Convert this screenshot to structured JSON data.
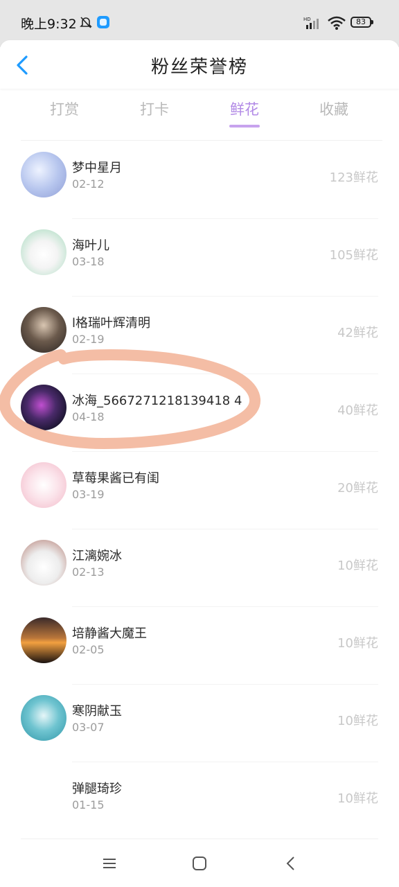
{
  "status": {
    "time": "晚上9:32",
    "battery": "83",
    "icons": [
      "bell-off-icon",
      "app-notification-icon",
      "hd-signal-icon",
      "wifi-icon",
      "battery-icon"
    ]
  },
  "header": {
    "title": "粉丝荣誉榜",
    "back_icon": "chevron-left-icon"
  },
  "tabs": [
    {
      "label": "打赏",
      "active": false
    },
    {
      "label": "打卡",
      "active": false
    },
    {
      "label": "鲜花",
      "active": true
    },
    {
      "label": "收藏",
      "active": false
    }
  ],
  "colors": {
    "accent": "#b28ae6",
    "highlight_marker": "#f3b9a0"
  },
  "fans": [
    {
      "name": "梦中星月",
      "date": "02-12",
      "value": "123鲜花"
    },
    {
      "name": "海叶儿",
      "date": "03-18",
      "value": "105鲜花"
    },
    {
      "name": "l格瑞叶辉清明",
      "date": "02-19",
      "value": "42鲜花"
    },
    {
      "name": "冰海_5667271218139418 4",
      "date": "04-18",
      "value": "40鲜花"
    },
    {
      "name": "草莓果酱已有闺",
      "date": "03-19",
      "value": "20鲜花"
    },
    {
      "name": "江漓婉冰",
      "date": "02-13",
      "value": "10鲜花"
    },
    {
      "name": "培静酱大魔王",
      "date": "02-05",
      "value": "10鲜花"
    },
    {
      "name": "寒阴献玉",
      "date": "03-07",
      "value": "10鲜花"
    },
    {
      "name": "弹腿琦珍",
      "date": "01-15",
      "value": "10鲜花"
    }
  ],
  "system_nav": [
    "menu-icon",
    "home-icon",
    "back-icon"
  ]
}
